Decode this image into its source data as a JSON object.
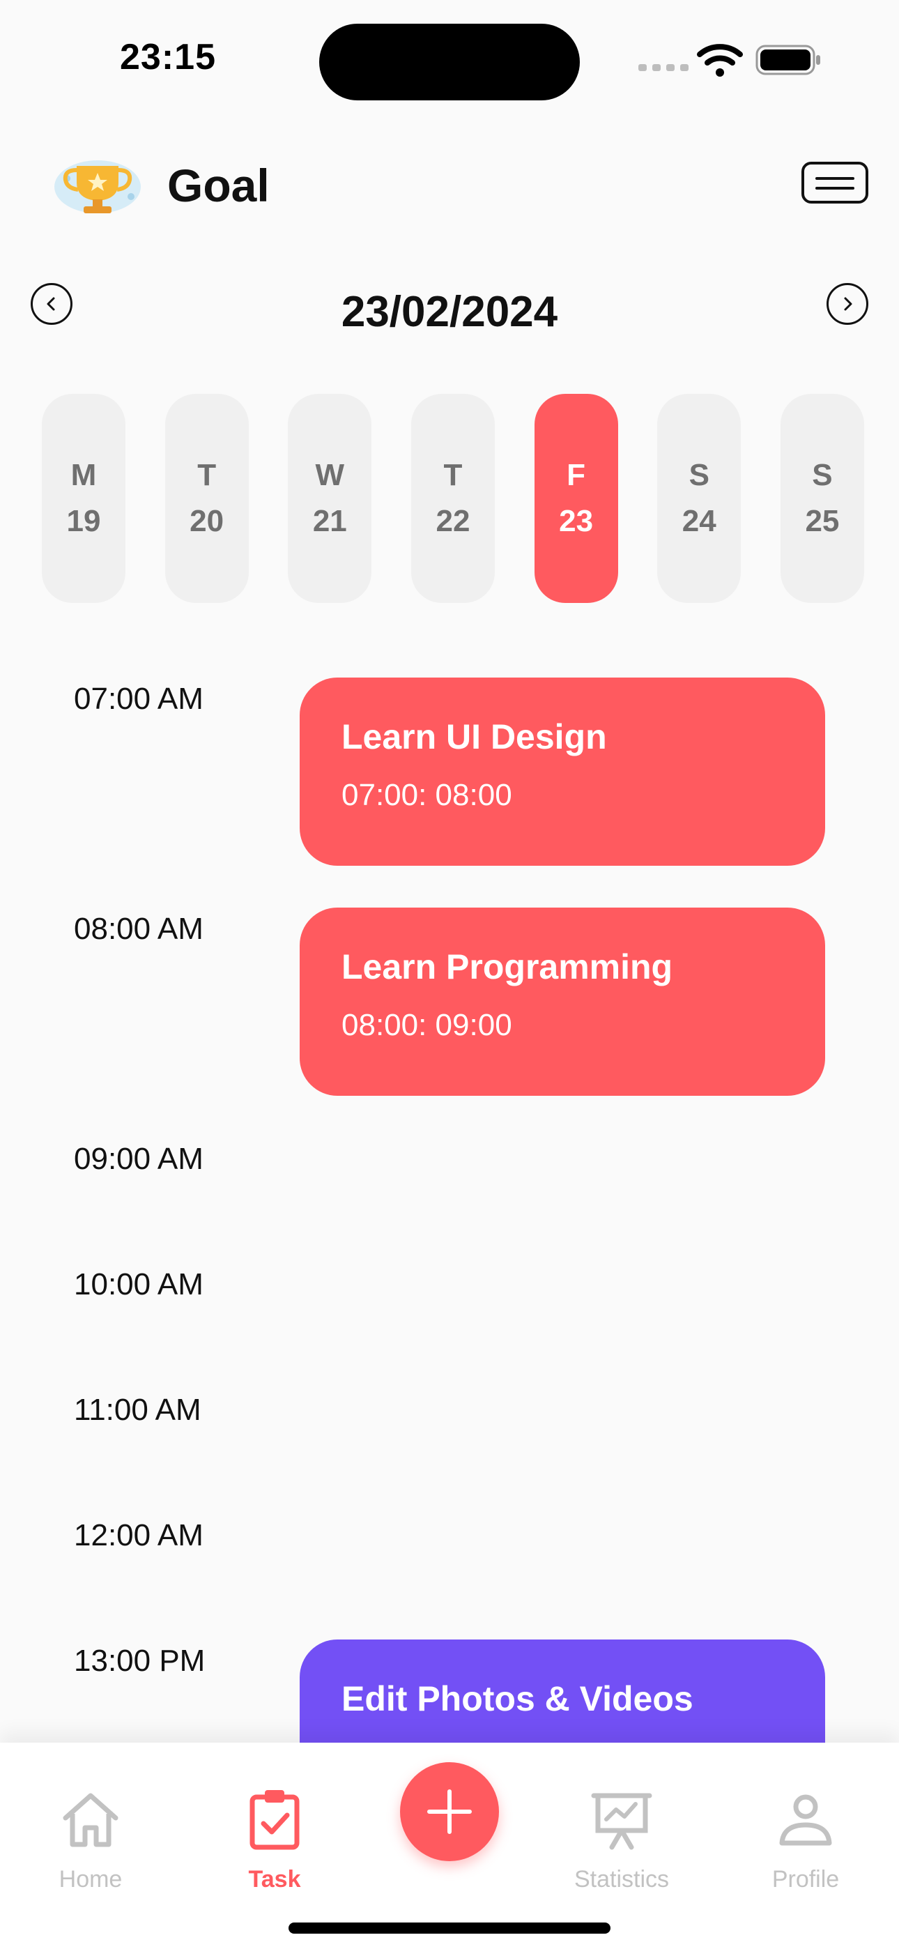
{
  "status_bar": {
    "time": "23:15"
  },
  "header": {
    "title": "Goal",
    "logo_icon": "trophy-icon",
    "menu_icon": "menu-icon"
  },
  "date_nav": {
    "current_date": "23/02/2024",
    "prev_icon": "chevron-left-icon",
    "next_icon": "chevron-right-icon"
  },
  "week": {
    "days": [
      {
        "letter": "M",
        "number": "19",
        "active": false
      },
      {
        "letter": "T",
        "number": "20",
        "active": false
      },
      {
        "letter": "W",
        "number": "21",
        "active": false
      },
      {
        "letter": "T",
        "number": "22",
        "active": false
      },
      {
        "letter": "F",
        "number": "23",
        "active": true
      },
      {
        "letter": "S",
        "number": "24",
        "active": false
      },
      {
        "letter": "S",
        "number": "25",
        "active": false
      }
    ]
  },
  "schedule": {
    "time_slots": [
      "07:00 AM",
      "08:00 AM",
      "09:00 AM",
      "10:00 AM",
      "11:00 AM",
      "12:00 AM",
      "13:00 PM"
    ],
    "tasks": [
      {
        "title": "Learn UI Design",
        "time_range": "07:00: 08:00",
        "color": "#ff5a5f"
      },
      {
        "title": "Learn Programming",
        "time_range": "08:00: 09:00",
        "color": "#ff5a5f"
      },
      {
        "title": "Edit Photos & Videos",
        "time_range": "",
        "color": "#7350f5"
      }
    ]
  },
  "bottom_nav": {
    "items": [
      {
        "label": "Home",
        "icon": "home-icon",
        "active": false
      },
      {
        "label": "Task",
        "icon": "task-clipboard-icon",
        "active": true
      },
      {
        "label": "Statistics",
        "icon": "statistics-board-icon",
        "active": false
      },
      {
        "label": "Profile",
        "icon": "profile-icon",
        "active": false
      }
    ],
    "add_icon": "plus-icon"
  },
  "colors": {
    "accent": "#ff5a5f",
    "purple": "#7350f5",
    "inactive": "#c2c2c2",
    "pill_bg": "#f0f0f0"
  }
}
